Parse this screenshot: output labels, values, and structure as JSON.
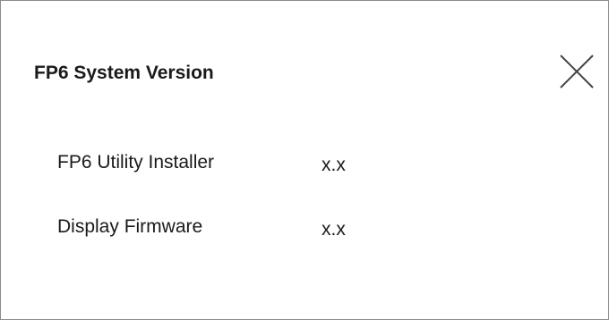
{
  "dialog": {
    "title": "FP6 System Version",
    "close_icon": "close-icon",
    "rows": [
      {
        "label": "FP6 Utility Installer",
        "value": "x.x"
      },
      {
        "label": "Display Firmware",
        "value": "x.x"
      }
    ]
  }
}
